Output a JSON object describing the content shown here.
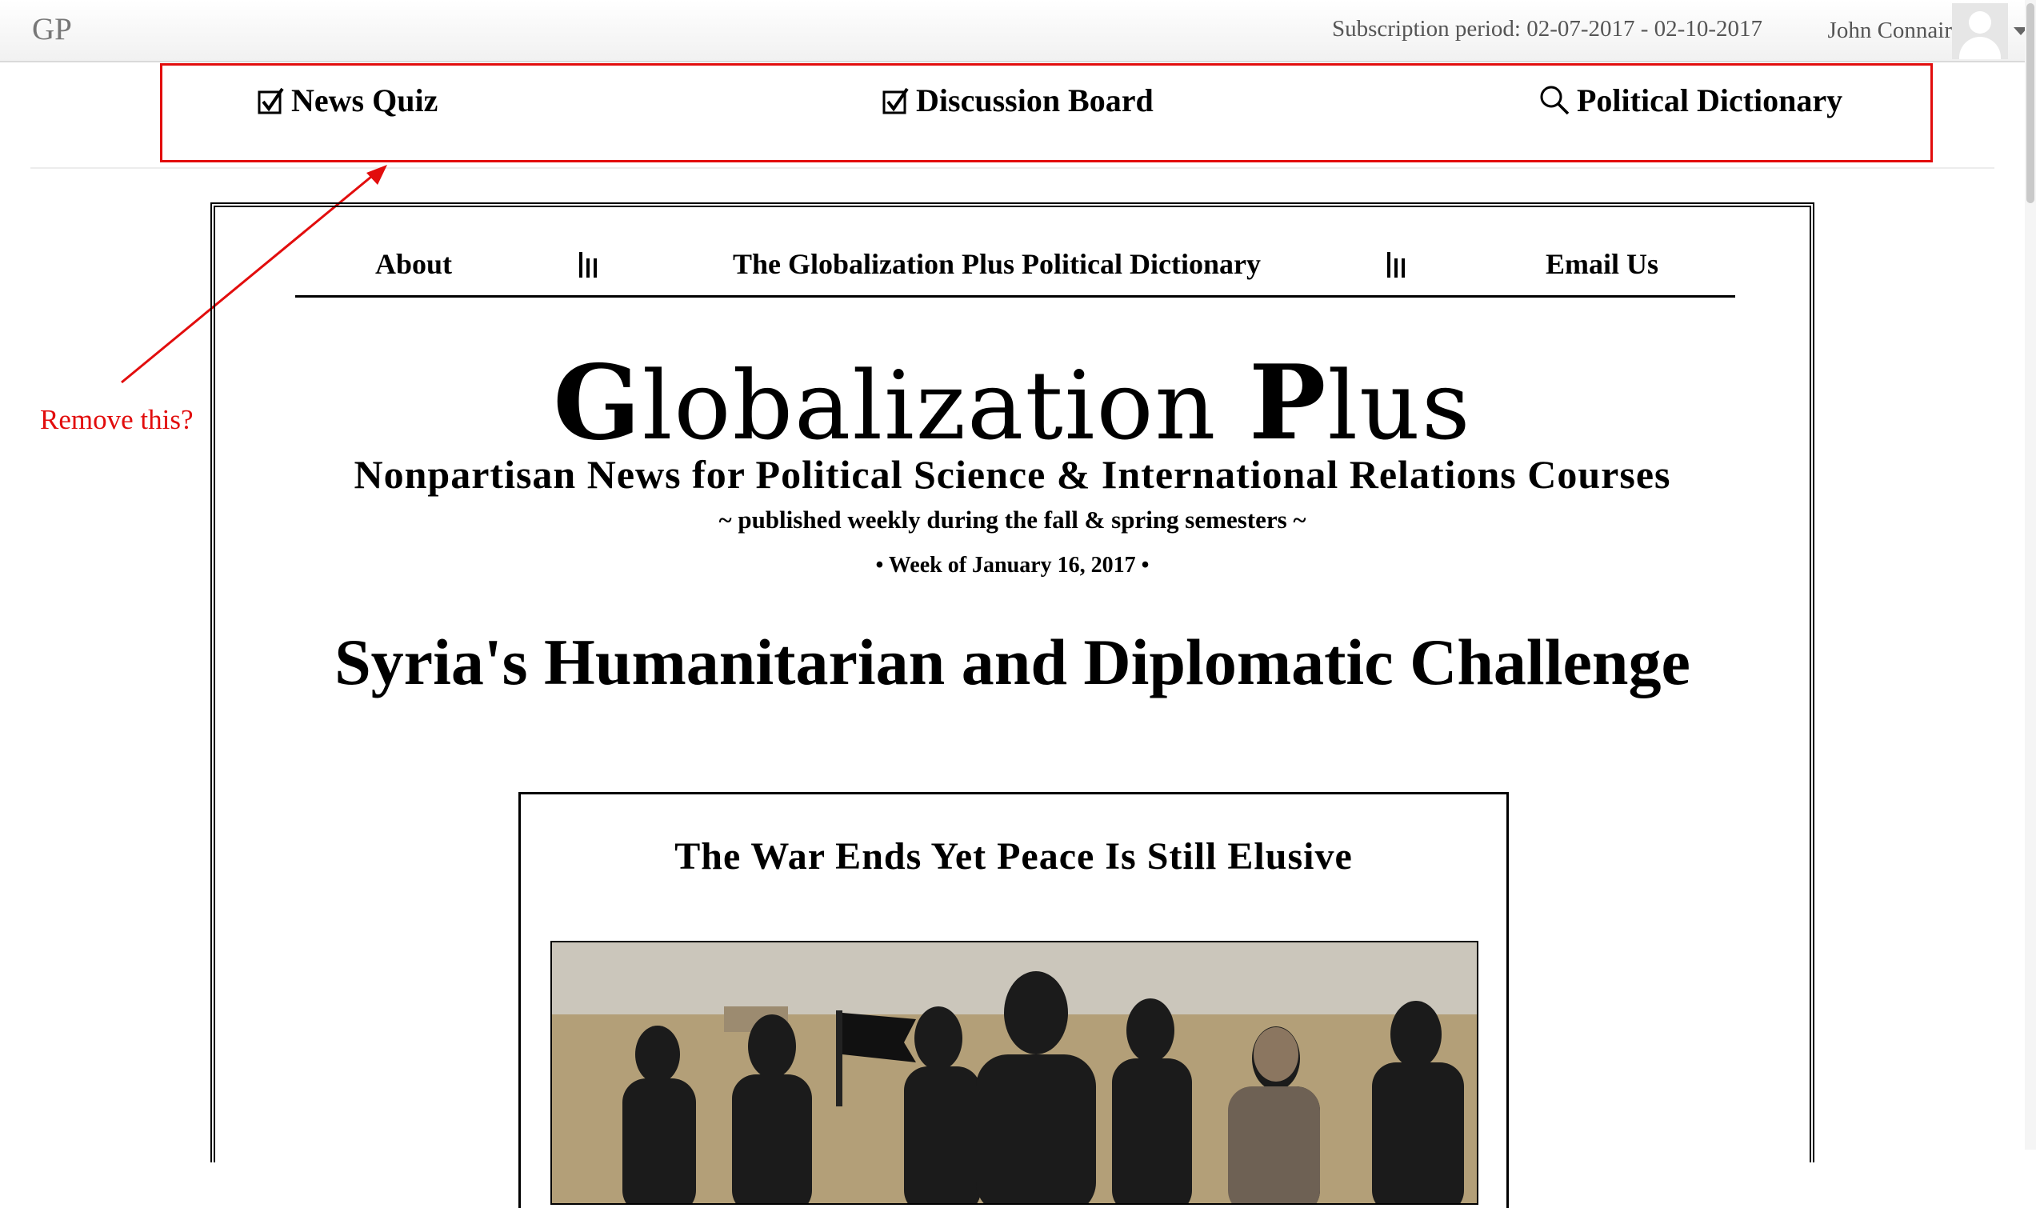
{
  "app": {
    "brand": "GP",
    "subscription": "Subscription period: 02-07-2017 - 02-10-2017",
    "user_name": "John Connair"
  },
  "tools": [
    {
      "label": "News Quiz",
      "icon": "checkbox-checked-icon"
    },
    {
      "label": "Discussion Board",
      "icon": "checkbox-checked-icon"
    },
    {
      "label": "Political Dictionary",
      "icon": "search-icon"
    }
  ],
  "annotation": {
    "text": "Remove this?",
    "color": "#e20d0d"
  },
  "newsletter": {
    "nav": {
      "about": "About",
      "dictionary": "The Globalization Plus Political Dictionary",
      "email": "Email Us"
    },
    "title_cap1": "G",
    "title_rest1": "lobalization ",
    "title_cap2": "P",
    "title_rest2": "lus",
    "subtitle": "Nonpartisan News for Political Science & International Relations Courses",
    "published": "~ published weekly during the fall & spring semesters ~",
    "week": "• Week of January 16, 2017 •",
    "headline": "Syria's Humanitarian and Diplomatic Challenge",
    "story_title": "The War Ends Yet Peace Is Still Elusive"
  }
}
